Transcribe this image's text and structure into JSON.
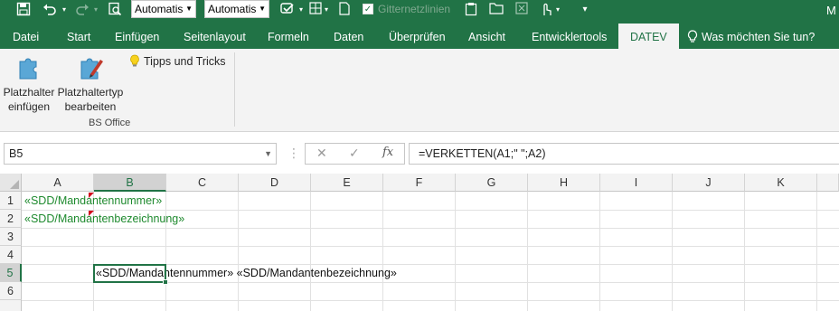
{
  "qat": {
    "font_name": "Automatis",
    "font_size": "Automatis",
    "gridlines_label": "Gitternetzlinien",
    "user_initial": "M"
  },
  "tabs": [
    "Datei",
    "Start",
    "Einfügen",
    "Seitenlayout",
    "Formeln",
    "Daten",
    "Überprüfen",
    "Ansicht",
    "Entwicklertools",
    "DATEV"
  ],
  "active_tab": "DATEV",
  "tell_me": "Was möchten Sie tun?",
  "ribbon": {
    "btn_insert_line1": "Platzhalter",
    "btn_insert_line2": "einfügen",
    "btn_edit_line1": "Platzhaltertyp",
    "btn_edit_line2": "bearbeiten",
    "tips": "Tipps und Tricks",
    "group_label": "BS Office"
  },
  "formula_bar": {
    "name_box": "B5",
    "cancel": "✕",
    "enter": "✓",
    "fx": "fx",
    "formula": "=VERKETTEN(A1;\" \";A2)"
  },
  "columns": [
    "A",
    "B",
    "C",
    "D",
    "E",
    "F",
    "G",
    "H",
    "I",
    "J",
    "K"
  ],
  "rows": [
    "1",
    "2",
    "3",
    "4",
    "5",
    "6"
  ],
  "selected_column": "B",
  "selected_row": "5",
  "cells": {
    "A1": "«SDD/Mandantennummer»",
    "A2": "«SDD/Mandantenbezeichnung»",
    "B5": "«SDD/Mandantennummer» «SDD/Mandantenbezeichnung»"
  },
  "colors": {
    "accent": "#217346",
    "merge_field_text": "#1e8a2e",
    "comment_marker": "#d0021b"
  }
}
